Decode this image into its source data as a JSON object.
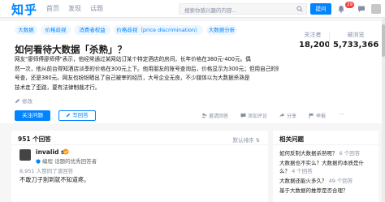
{
  "topbar": {
    "logo": "知乎",
    "nav": [
      "首页",
      "发现",
      "话题"
    ],
    "search_placeholder": "搜索你感兴趣的内容...",
    "ask_label": "提问",
    "notification_count": "29"
  },
  "question": {
    "tags": [
      "大数据",
      "价格歧视",
      "消费者权益",
      "价格歧视（price discrimination）",
      "大数据分析"
    ],
    "title": "如何看待大数据「杀熟」？",
    "detail_lines": [
      "网友\"廖师傅廖师傅\"表示，他经常通过某网站订某个特定酒店的房间，长年价格在380元-400元。偶",
      "然一次，他从前台得知酒店淡季的价格在300元上下。他用朋友的账号查询后，价格显示为300元；但用自己的账",
      "号查，还是380元。网友也纷纷晒出了自己被宰的经历，大号企业无良，不少媒体以为大数据杀熟是",
      "技术走了歪路，要有法律制裁才行。"
    ],
    "edit_label": "修改",
    "stats": {
      "followers_label": "关注者",
      "followers": "18,200",
      "views_label": "被浏览",
      "views": "5,733,366"
    },
    "follow_label": "关注问题",
    "answer_label": "写回答",
    "actions": [
      "邀请回答",
      "添加评论",
      "分享",
      "举报"
    ]
  },
  "answers": {
    "count_label": "951 个回答",
    "sort_label": "默认排序",
    "first": {
      "author": "invalid s",
      "bio": "编程 话题的优秀回答者",
      "votes": "8,951 人赞同了该回答",
      "excerpt": "不敢刀子割到就不知道疼。"
    }
  },
  "related": {
    "title": "相关问题",
    "items": [
      {
        "q": "如何反制大数据杀熟呢？",
        "count": "6 个回答"
      },
      {
        "q": "大数据也不实么？大数据的本质是什",
        "count": ""
      },
      {
        "q": "么？",
        "count": "4 个回答"
      },
      {
        "q": "大数据还能火多久？",
        "count": "49 个回答"
      },
      {
        "q": "基于大数据的推荐是否合理？",
        "count": ""
      }
    ]
  }
}
